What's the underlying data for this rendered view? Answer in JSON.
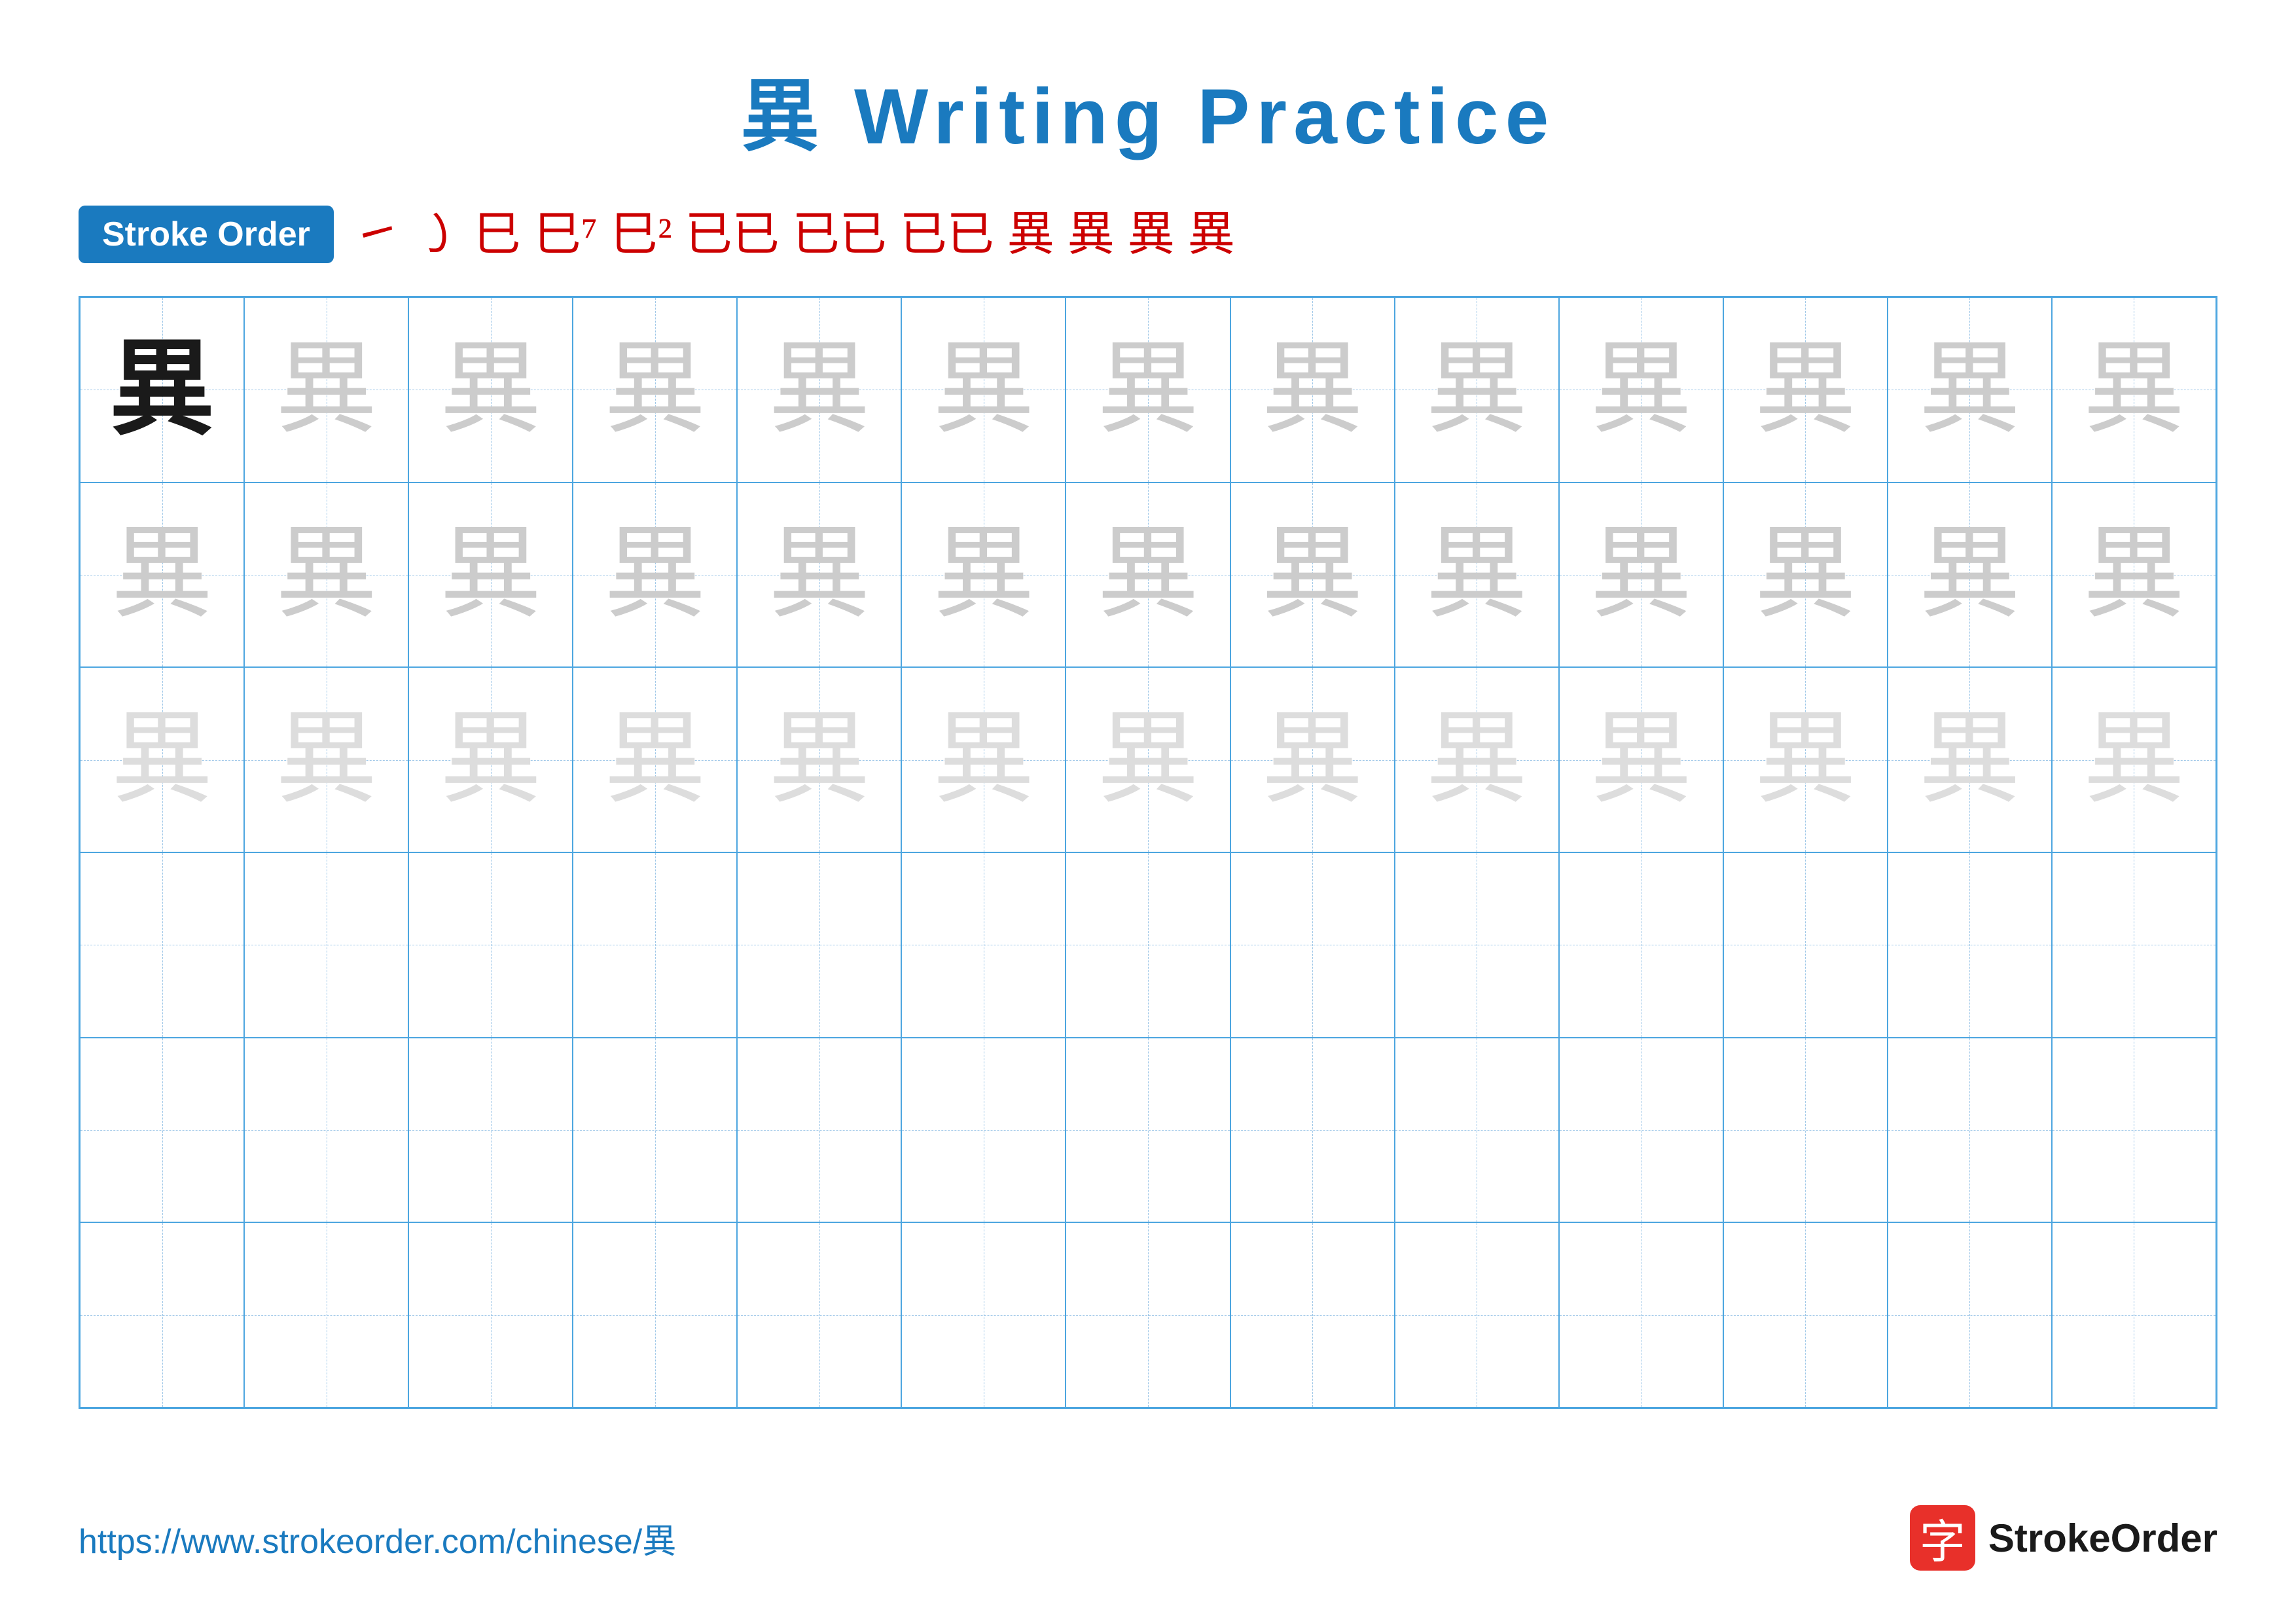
{
  "title": "異 Writing Practice",
  "stroke_order": {
    "label": "Stroke Order",
    "steps": [
      "㇀",
      "㇁",
      "巳",
      "巳⁷",
      "巳²",
      "已已",
      "已已",
      "已已",
      "異",
      "異",
      "異",
      "異"
    ]
  },
  "character": "異",
  "rows": [
    {
      "type": "dark_then_light",
      "dark_count": 1,
      "light_count": 12
    },
    {
      "type": "light",
      "count": 13
    },
    {
      "type": "lighter",
      "count": 13
    },
    {
      "type": "empty",
      "count": 13
    },
    {
      "type": "empty",
      "count": 13
    },
    {
      "type": "empty",
      "count": 13
    }
  ],
  "footer": {
    "url": "https://www.strokeorder.com/chinese/異",
    "logo_text": "StrokeOrder",
    "logo_char": "字"
  }
}
